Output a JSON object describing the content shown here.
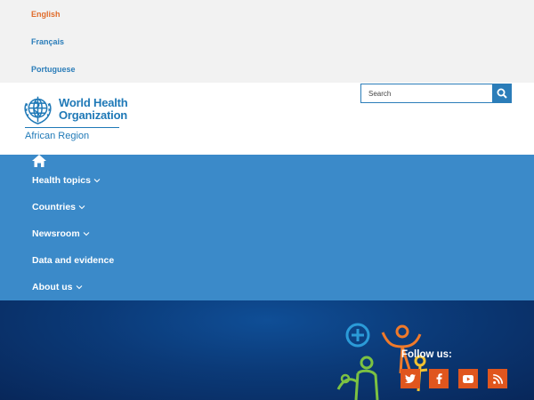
{
  "languages": [
    {
      "label": "English",
      "active": true
    },
    {
      "label": "Français",
      "active": false
    },
    {
      "label": "Portuguese",
      "active": false
    }
  ],
  "logo": {
    "name_line1": "World Health",
    "name_line2": "Organization",
    "region": "African Region"
  },
  "search": {
    "placeholder": "Search",
    "icon": "search-icon"
  },
  "nav": {
    "home_icon": "home-icon",
    "items": [
      {
        "label": "Health topics",
        "has_dropdown": true
      },
      {
        "label": "Countries",
        "has_dropdown": true
      },
      {
        "label": "Newsroom",
        "has_dropdown": true
      },
      {
        "label": "Data and evidence",
        "has_dropdown": false
      },
      {
        "label": "About us",
        "has_dropdown": true
      }
    ]
  },
  "footer": {
    "follow_label": "Follow us:",
    "social": [
      {
        "name": "twitter-icon"
      },
      {
        "name": "facebook-icon"
      },
      {
        "name": "youtube-icon"
      },
      {
        "name": "rss-icon"
      }
    ]
  },
  "colors": {
    "accent": "#e06c2b",
    "link": "#2b7db9",
    "nav_bg": "#3b8ac9",
    "footer_bg": "#0b3a78",
    "social_bg": "#e0561e"
  }
}
